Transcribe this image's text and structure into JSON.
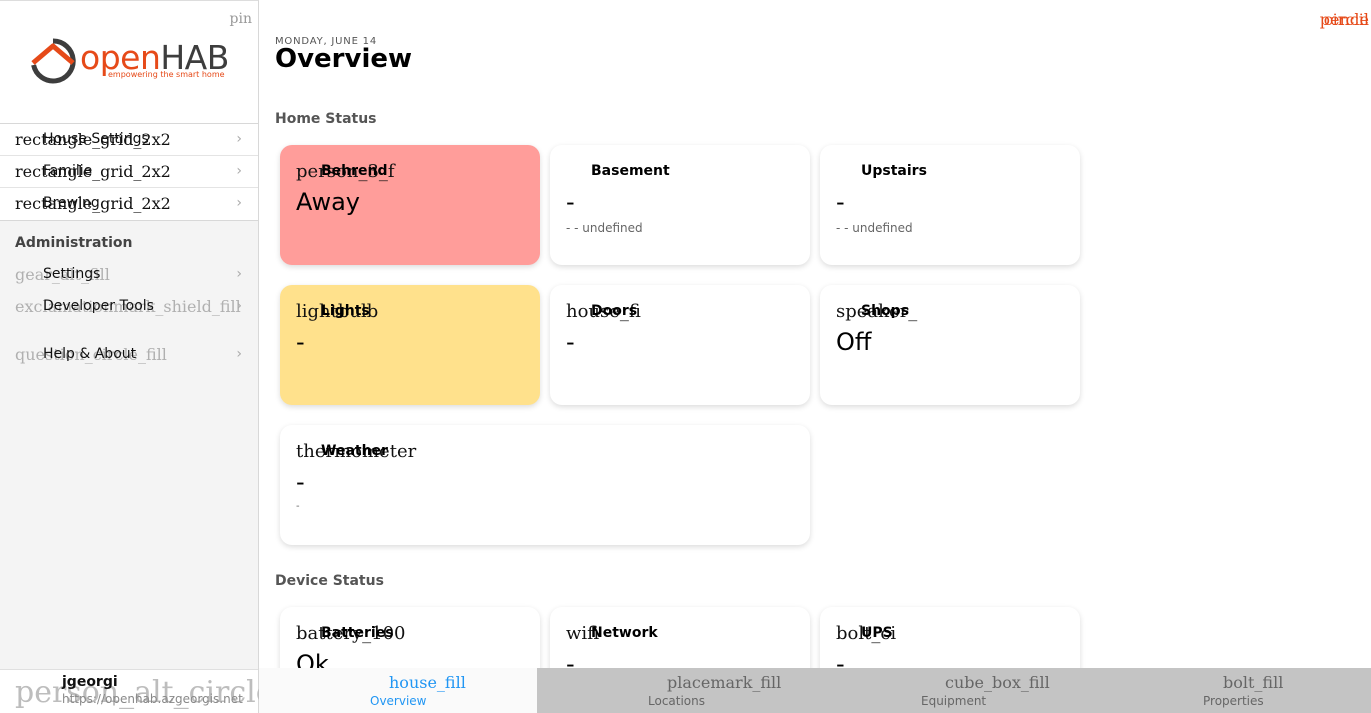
{
  "sidebar": {
    "pin_icon": "pin",
    "logo": {
      "open": "open",
      "hab": "HAB",
      "tagline": "empowering the smart home"
    },
    "main_items": [
      {
        "icon": "rectangle_grid_2x2",
        "label": "House Settings"
      },
      {
        "icon": "rectangle_grid_2x2",
        "label": "Familie"
      },
      {
        "icon": "rectangle_grid_2x2",
        "label": "Brewing"
      }
    ],
    "admin_title": "Administration",
    "admin_items": [
      {
        "icon": "gear_alt_fill",
        "label": "Settings"
      },
      {
        "icon": "exclamationmark_shield_fill",
        "label": "Developer Tools"
      }
    ],
    "help_item": {
      "icon": "question_circle_fill",
      "label": "Help & About"
    },
    "user": {
      "icon": "person_alt_circle",
      "name": "jgeorgi",
      "url": "https://openhab.azgeorgis.net"
    }
  },
  "header": {
    "edit_icon": "pencil",
    "edit_icon_overlay": "circle",
    "date": "MONDAY, JUNE 14",
    "title": "Overview"
  },
  "home_status": {
    "title": "Home Status",
    "cards": [
      {
        "icon": "person_3_f",
        "title": "Behrend",
        "value": "Away",
        "sub": "",
        "color": "#ff9d9a"
      },
      {
        "icon": "",
        "title": "Basement",
        "value": "-",
        "sub": "- - undefined",
        "color": "#ffffff"
      },
      {
        "icon": "",
        "title": "Upstairs",
        "value": "-",
        "sub": "- - undefined",
        "color": "#ffffff"
      },
      {
        "icon": "lightbulb",
        "title": "Lights",
        "value": "-",
        "sub": "",
        "color": "#ffe18c"
      },
      {
        "icon": "house_fi",
        "title": "Doors",
        "value": "-",
        "sub": "",
        "color": "#ffffff"
      },
      {
        "icon": "speaker_",
        "title": "Shops",
        "value": "Off",
        "sub": "",
        "color": "#ffffff"
      },
      {
        "icon": "thermometer",
        "title": "Weather",
        "value": "-",
        "sub": "-",
        "color": "#ffffff"
      }
    ]
  },
  "device_status": {
    "title": "Device Status",
    "cards": [
      {
        "icon": "battery_100",
        "title": "Batteries",
        "value": "Ok"
      },
      {
        "icon": "wifi",
        "title": "Network",
        "value": "-"
      },
      {
        "icon": "bolt_ci",
        "title": "UPS",
        "value": "-"
      }
    ]
  },
  "tabbar": [
    {
      "icon": "house_fill",
      "label": "Overview",
      "active": true
    },
    {
      "icon": "placemark_fill",
      "label": "Locations",
      "active": false
    },
    {
      "icon": "cube_box_fill",
      "label": "Equipment",
      "active": false
    },
    {
      "icon": "bolt_fill",
      "label": "Properties",
      "active": false
    }
  ],
  "colors": {
    "accent": "#e64a19",
    "active_tab": "#2196f3",
    "tabbar_bg": "#c4c4c4"
  }
}
